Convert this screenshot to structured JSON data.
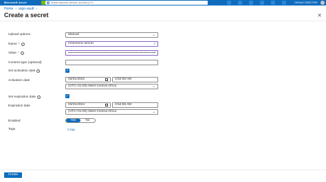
{
  "topbar": {
    "brand": "Microsoft Azure",
    "search_placeholder": "Search resources, services, and docs (G+/)",
    "directory": "DEFAULT DIRECTORY"
  },
  "breadcrumb": [
    "Home",
    "argo-vault"
  ],
  "page_title": "Create a secret",
  "form": {
    "upload_options": {
      "label": "Upload options",
      "value": "Manual"
    },
    "name": {
      "label": "Name",
      "value": "mnemonic-secret"
    },
    "value": {
      "label": "Value",
      "masked": "••••••••••••••••••••••••••••••••••••••••••••••••••••••••••••••••••••••••"
    },
    "content_type": {
      "label": "Content type (optional)",
      "value": ""
    },
    "set_activation": {
      "label": "Set activation date"
    },
    "activation_date": {
      "label": "Activation date",
      "date": "03/31/2022",
      "time": "3:52:59 AM",
      "timezone": "(UTC+01:00) West Central Africa"
    },
    "set_expiration": {
      "label": "Set expiration date"
    },
    "expiration_date": {
      "label": "Expiration date",
      "date": "03/31/2024",
      "time": "3:52:59 AM",
      "timezone": "(UTC+01:00) West Central Africa"
    },
    "enabled": {
      "label": "Enabled",
      "yes": "Yes",
      "no": "No",
      "selected": "Yes"
    },
    "tags": {
      "label": "Tags",
      "link": "0 tag"
    }
  },
  "footer": {
    "create_label": "Create"
  },
  "colors": {
    "accent": "#0f6cbd",
    "focus": "#8661c5"
  }
}
